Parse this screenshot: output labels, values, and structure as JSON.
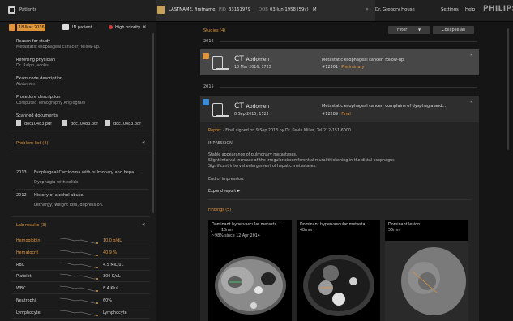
{
  "colors": {
    "accent": "#e0943a",
    "final": "#e0943a",
    "danger": "#d63a3a",
    "bg_dark": "#101010"
  },
  "topbar": {
    "patients_label": "Patients",
    "patient_name": "LASTNAME, firstname",
    "pid_label": "PID",
    "pid_value": "33161979",
    "dob_label": "DOB",
    "dob_value": "03 Jun 1958 (59y)",
    "sex": "M",
    "doctor": "Dr. Gregory House",
    "settings": "Settings",
    "help": "Help",
    "brand": "PHILIPS"
  },
  "left": {
    "header": {
      "date": "18 Mar 2016",
      "patient_type": "IN patient",
      "priority": "High priority"
    },
    "fields": [
      {
        "label": "Reason for study",
        "value": "Metastatic esophageal canacer, follow-up."
      },
      {
        "label": "Referring physician",
        "value": "Dr. Ralph Jacobs"
      },
      {
        "label": "Exam code description",
        "value": "Abdomen"
      },
      {
        "label": "Procedure description",
        "value": "Computed Tomography Angiogram"
      }
    ],
    "scanned_label": "Scanned documents",
    "documents": [
      "doc10483.pdf",
      "doc10483.pdf",
      "doc10483.pdf"
    ],
    "problem_list_title": "Problem list (4)",
    "problems": [
      {
        "year": "2013",
        "text": "Esophageal Carcinoma with pulmonary and hepa...",
        "sub": "Dysphagia with solids"
      },
      {
        "year": "2012",
        "text": "History of alcohol abuse.",
        "sub": "Lethargy, weight loss, depression."
      }
    ],
    "lab_title": "Lab results (3)",
    "labs": [
      {
        "name": "Hemoglobin",
        "value": "10.0 g/dL",
        "abnormal": true
      },
      {
        "name": "Hematocrit",
        "value": "40.9 %",
        "abnormal": true
      },
      {
        "name": "RBC",
        "value": "4.5 MIL/uL",
        "abnormal": false
      },
      {
        "name": "Platelet",
        "value": "300 K/uL",
        "abnormal": false
      },
      {
        "name": "WBC",
        "value": "8.4 K/uL",
        "abnormal": false
      },
      {
        "name": "Neutrophil",
        "value": "60%",
        "abnormal": false
      },
      {
        "name": "Lymphocyte",
        "value": "Lymphocyte",
        "abnormal": false
      }
    ]
  },
  "right": {
    "studies_title": "Studies (4)",
    "filter_label": "Filter",
    "collapse_label": "Collapse all",
    "years": [
      "2016",
      "2015"
    ],
    "study1": {
      "modality": "CT",
      "body": "Abdomen",
      "date": "18 Mar 2016, 1725",
      "desc": "Metastatic esophageal cancer, follow-up.",
      "number": "#12301",
      "status": "Preliminary"
    },
    "study2": {
      "modality": "CT",
      "body": "Abdomen",
      "date": "8 Sep 2015, 1523",
      "desc": "Metastatic esophageal cancer, complains of dysphagia and...",
      "number": "#12289",
      "status": "Final",
      "report_link": "Report",
      "report_meta": "- Final signed on 9 Sep 2013 by Dr. Kevin Miller, Tel 212-151-6000",
      "impression_title": "IMPRESSION:",
      "impression_lines": [
        "Stable appearance of pulmonary metastases.",
        "Slight interval increase of the irregular circumferential mural thickening in the distal esophagus.",
        "Significant interval enlargement of hepatic metastases."
      ],
      "end_text": "End of impression.",
      "expand_label": "Expand report ►",
      "findings_title": "Findings (5)"
    },
    "findings": [
      {
        "title": "Dominant hypervascular metasta...",
        "line1": "18mm",
        "line2": "~98% since 12 Apr 2014"
      },
      {
        "title": "Dominant hypervascular metasta...",
        "line1": "48mm",
        "line2": ""
      },
      {
        "title": "Dominant lesion",
        "line1": "56mm",
        "line2": ""
      }
    ]
  }
}
